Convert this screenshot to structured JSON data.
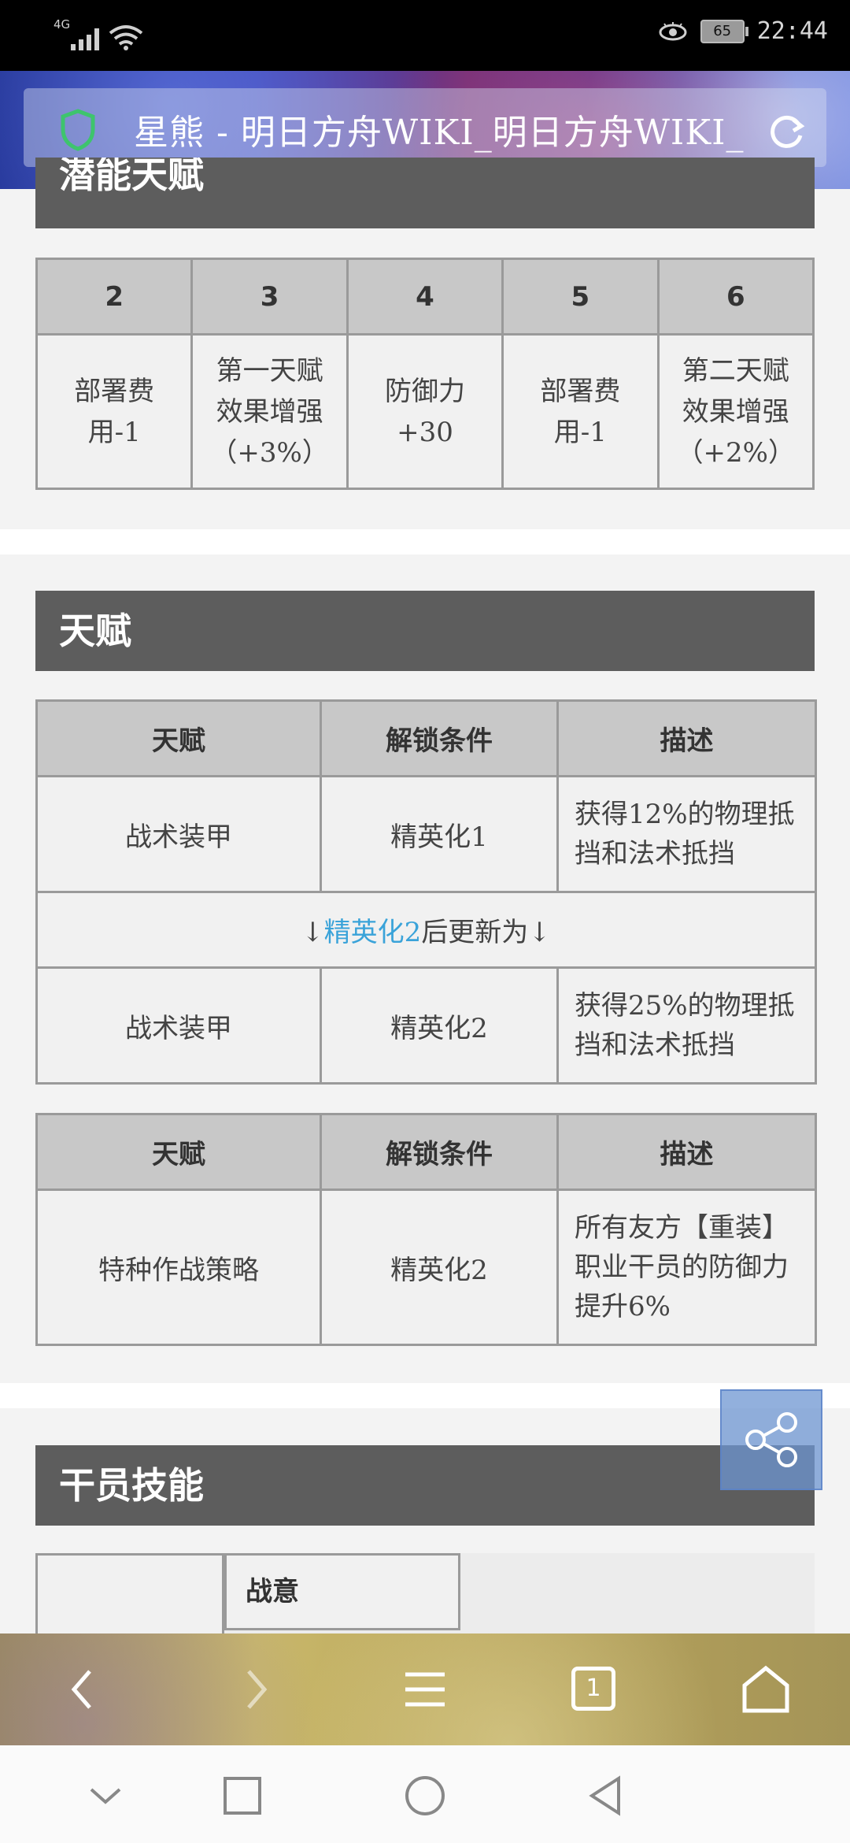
{
  "status_bar": {
    "network": "4G",
    "battery": "65",
    "time": "22:44"
  },
  "browser": {
    "page_title": "星熊 - 明日方舟WIKI_明日方舟WIKI_",
    "tabs_count": "1"
  },
  "potential_section": {
    "title": "潜能天赋",
    "headers": [
      "2",
      "3",
      "4",
      "5",
      "6"
    ],
    "cells": [
      [
        "部署费",
        "用-1"
      ],
      [
        "第一天赋",
        "效果增强",
        "（+3%）"
      ],
      [
        "防御力",
        "+30"
      ],
      [
        "部署费",
        "用-1"
      ],
      [
        "第二天赋",
        "效果增强",
        "（+2%）"
      ]
    ]
  },
  "talent_section": {
    "title": "天赋",
    "table1": {
      "headers": [
        "天赋",
        "解锁条件",
        "描述"
      ],
      "row1": [
        "战术装甲",
        "精英化1",
        "获得12%的物理抵挡和法术抵挡"
      ],
      "update_prefix": "↓",
      "update_link": "精英化2",
      "update_suffix": "后更新为↓",
      "row2": [
        "战术装甲",
        "精英化2",
        "获得25%的物理抵挡和法术抵挡"
      ]
    },
    "table2": {
      "headers": [
        "天赋",
        "解锁条件",
        "描述"
      ],
      "row1": [
        "特种作战策略",
        "精英化2",
        "所有友方【重装】职业干员的防御力提升6%"
      ]
    }
  },
  "skill_section": {
    "title": "干员技能",
    "skill_name": "战意"
  }
}
